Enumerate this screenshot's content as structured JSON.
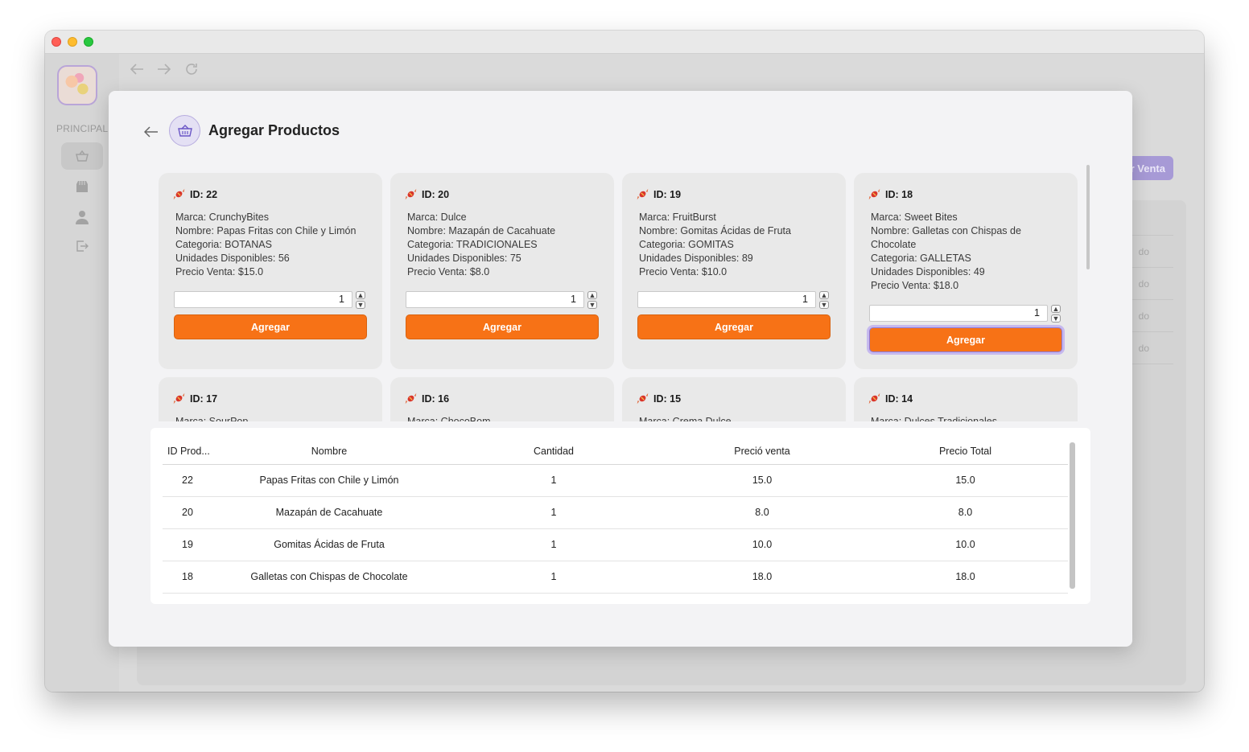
{
  "window": {
    "controls": [
      "close",
      "minimize",
      "zoom"
    ]
  },
  "background": {
    "sidebar_label": "PRINCIPAL",
    "button_label": "r Venta",
    "row_texts": [
      "do",
      "do",
      "do",
      "do"
    ]
  },
  "modal": {
    "title": "Agregar Productos",
    "cards": [
      {
        "id_label": "ID: 22",
        "marca": "Marca: CrunchyBites",
        "nombre": "Nombre: Papas Fritas con Chile y Limón",
        "categoria": "Categoria: BOTANAS",
        "unidades": "Unidades Disponibles: 56",
        "precio": "Precio Venta: $15.0",
        "qty": "1",
        "button": "Agregar"
      },
      {
        "id_label": "ID: 20",
        "marca": "Marca: Dulce",
        "nombre": "Nombre: Mazapán de Cacahuate",
        "categoria": "Categoria: TRADICIONALES",
        "unidades": "Unidades Disponibles: 75",
        "precio": "Precio Venta: $8.0",
        "qty": "1",
        "button": "Agregar"
      },
      {
        "id_label": "ID: 19",
        "marca": "Marca: FruitBurst",
        "nombre": "Nombre: Gomitas Ácidas de Fruta",
        "categoria": "Categoria: GOMITAS",
        "unidades": "Unidades Disponibles: 89",
        "precio": "Precio Venta: $10.0",
        "qty": "1",
        "button": "Agregar"
      },
      {
        "id_label": "ID: 18",
        "marca": "Marca: Sweet Bites",
        "nombre": "Nombre: Galletas con Chispas de Chocolate",
        "categoria": "Categoria: GALLETAS",
        "unidades": "Unidades Disponibles: 49",
        "precio": "Precio Venta: $18.0",
        "qty": "1",
        "button": "Agregar"
      },
      {
        "id_label": "ID: 17",
        "marca": "Marca: SourPop"
      },
      {
        "id_label": "ID: 16",
        "marca": "Marca: ChocoBom"
      },
      {
        "id_label": "ID: 15",
        "marca": "Marca: Crema Dulce"
      },
      {
        "id_label": "ID: 14",
        "marca": "Marca: Dulces Tradicionales"
      }
    ],
    "table": {
      "headers": [
        "ID Prod...",
        "Nombre",
        "Cantidad",
        "Preció venta",
        "Precio Total"
      ],
      "rows": [
        [
          "22",
          "Papas Fritas con Chile y Limón",
          "1",
          "15.0",
          "15.0"
        ],
        [
          "20",
          "Mazapán de Cacahuate",
          "1",
          "8.0",
          "8.0"
        ],
        [
          "19",
          "Gomitas Ácidas de Fruta",
          "1",
          "10.0",
          "10.0"
        ],
        [
          "18",
          "Galletas con Chispas de Chocolate",
          "1",
          "18.0",
          "18.0"
        ]
      ]
    }
  },
  "colors": {
    "accent_orange": "#f77216",
    "accent_purple": "#8e7ad8"
  }
}
